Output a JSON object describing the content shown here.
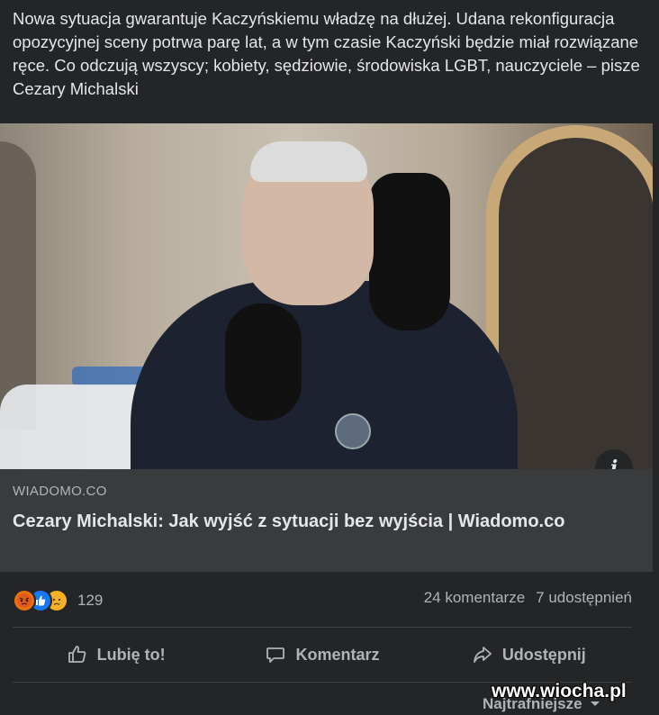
{
  "post": {
    "text": "Nowa sytuacja gwarantuje Kaczyńskiemu władzę na dłużej. Udana rekonfiguracja opozycyjnej sceny potrwa parę lat, a w tym czasie Kaczyński będzie miał rozwiązane ręce. Co odczują wszyscy; kobiety, sędziowie, środowiska LGBT, nauczyciele – pisze Cezary Michalski"
  },
  "link": {
    "domain": "WIADOMO.CO",
    "title": "Cezary Michalski: Jak wyjść z sytuacji bez wyjścia | Wiadomo.co",
    "info_icon": "i"
  },
  "stats": {
    "reactions": [
      "angry-reaction-icon",
      "like-reaction-icon",
      "sad-reaction-icon"
    ],
    "reaction_count": "129",
    "comments": "24 komentarze",
    "shares": "7 udostępnień"
  },
  "actions": {
    "like": "Lubię to!",
    "comment": "Komentarz",
    "share": "Udostępnij"
  },
  "sort": {
    "label": "Najtrafniejsze"
  },
  "watermark": "www.wiocha.pl",
  "colors": {
    "background": "#242526",
    "card": "#3a3b3c",
    "text_primary": "#e4e6eb",
    "text_secondary": "#b0b3b8",
    "like_blue": "#1877f2"
  }
}
